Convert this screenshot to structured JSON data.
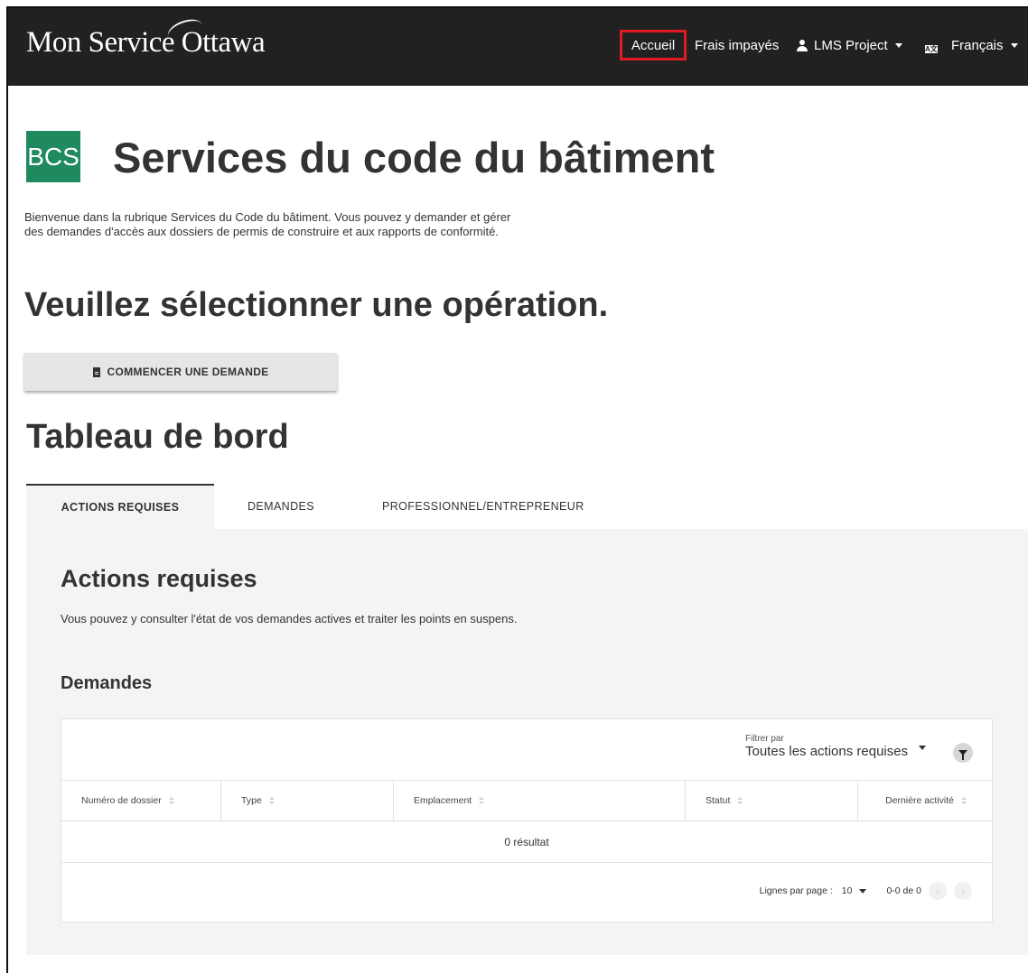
{
  "header": {
    "brand": "Mon Service Ottawa",
    "nav": {
      "accueil": "Accueil",
      "frais": "Frais impayés",
      "user": "LMS Project",
      "language": "Français"
    }
  },
  "page": {
    "logo_text": "BCS",
    "title": "Services du code du bâtiment",
    "intro": "Bienvenue dans la rubrique Services du Code du bâtiment. Vous pouvez y demander et gérer des demandes d'accès aux dossiers de permis de construire et aux rapports de conformité.",
    "select_heading": "Veuillez sélectionner une opération.",
    "start_button": "COMMENCER UNE DEMANDE",
    "dashboard_heading": "Tableau de bord"
  },
  "tabs": [
    {
      "label": "ACTIONS REQUISES",
      "active": true
    },
    {
      "label": "DEMANDES",
      "active": false
    },
    {
      "label": "PROFESSIONNEL/ENTREPRENEUR",
      "active": false
    }
  ],
  "panel": {
    "title": "Actions requises",
    "description": "Vous pouvez y consulter l'état de vos demandes actives et traiter les points en suspens.",
    "subheading": "Demandes",
    "filter": {
      "label": "Filtrer par",
      "value": "Toutes les actions requises"
    },
    "table": {
      "columns": [
        "Numéro de dossier",
        "Type",
        "Emplacement",
        "Statut",
        "Dernière activité"
      ],
      "empty_text": "0 résultat"
    },
    "pagination": {
      "rows_label": "Lignes par page :",
      "rows_value": "10",
      "range": "0-0 de 0"
    }
  }
}
